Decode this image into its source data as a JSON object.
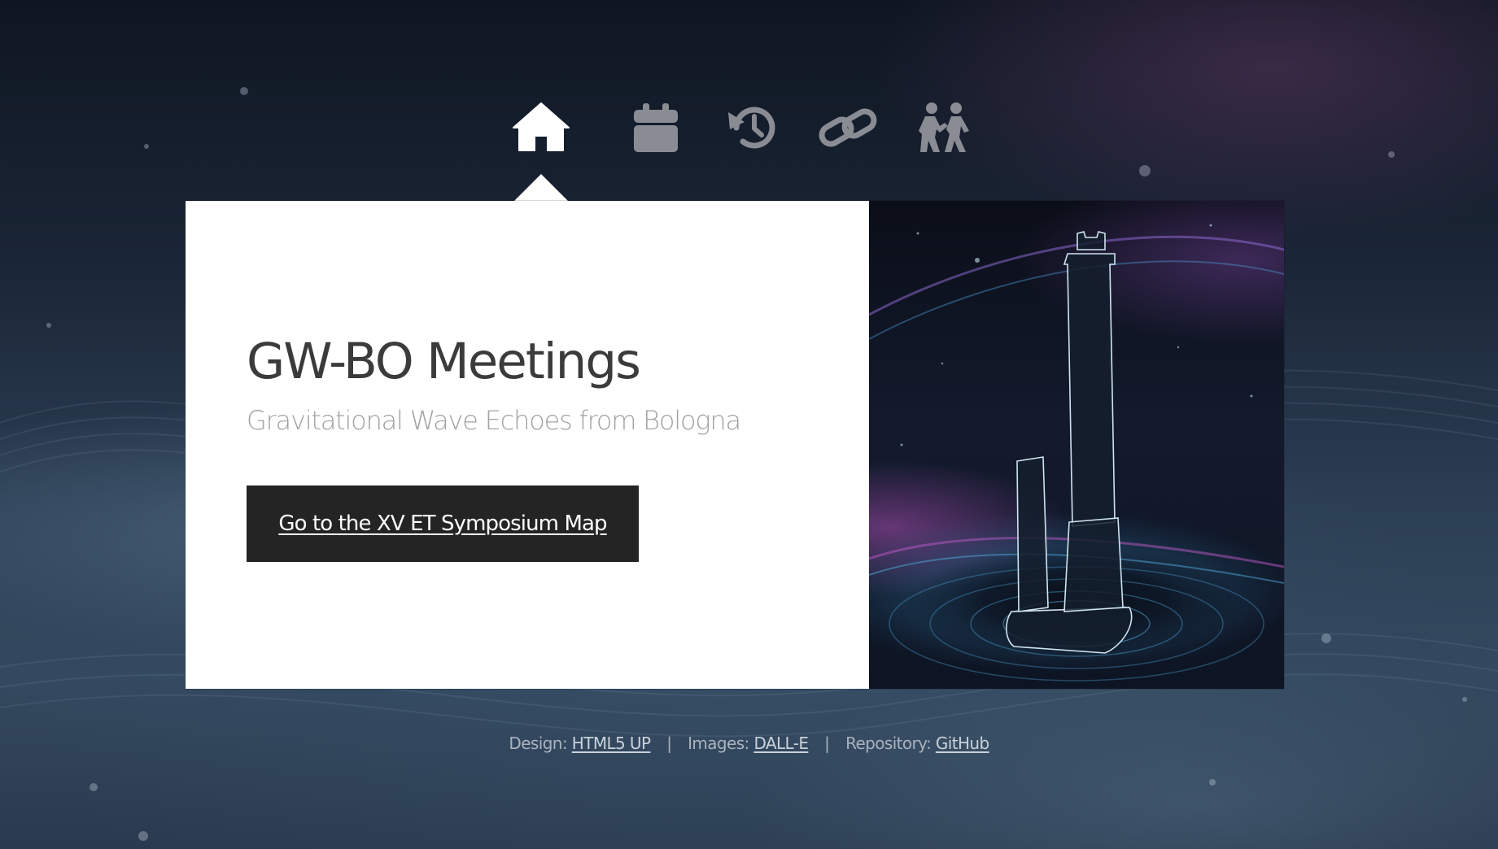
{
  "nav": {
    "items": [
      {
        "icon": "home-icon",
        "active": true
      },
      {
        "icon": "calendar-icon",
        "active": false
      },
      {
        "icon": "history-icon",
        "active": false
      },
      {
        "icon": "link-icon",
        "active": false
      },
      {
        "icon": "people-icon",
        "active": false
      }
    ],
    "active_color": "#ffffff",
    "inactive_color": "#8a8c93"
  },
  "main": {
    "title": "GW-BO Meetings",
    "subtitle": "Gravitational Wave Echoes from Bologna",
    "cta_label": "Go to the XV ET Symposium Map"
  },
  "footer": {
    "design_label": "Design:",
    "design_link": "HTML5 UP",
    "separator_1": "|",
    "images_label": "Images:",
    "images_link": "DALL-E",
    "separator_2": "|",
    "repo_label": "Repository:",
    "repo_link": "GitHub"
  },
  "colors": {
    "card_background": "#ffffff",
    "button_background": "#242424",
    "title_text": "#3b3b3b",
    "subtitle_text": "#a2a2a2"
  }
}
